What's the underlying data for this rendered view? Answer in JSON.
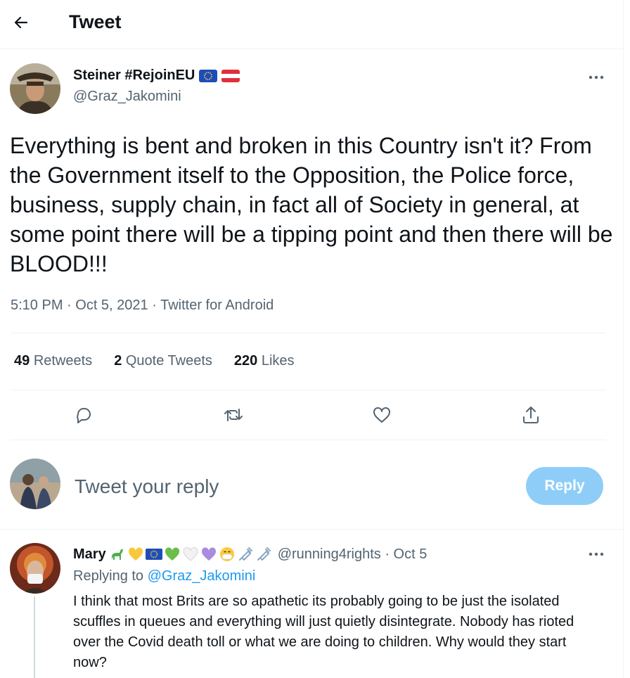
{
  "header": {
    "title": "Tweet"
  },
  "tweet": {
    "author_name": "Steiner #RejoinEU",
    "author_handle": "@Graz_Jakomini",
    "text": "Everything is bent and broken in this Country isn't it? From the Government itself to the Opposition, the Police force, business, supply chain, in fact all of Society in general, at some point there will be a tipping point and then there will be BLOOD!!!",
    "time": "5:10 PM",
    "date": "Oct 5, 2021",
    "source": "Twitter for Android",
    "retweets_count": "49",
    "retweets_label": "Retweets",
    "quotes_count": "2",
    "quotes_label": "Quote Tweets",
    "likes_count": "220",
    "likes_label": "Likes",
    "name_badges": [
      "eu-flag-icon",
      "austria-flag-icon"
    ]
  },
  "composer": {
    "placeholder": "Tweet your reply",
    "button_label": "Reply"
  },
  "reply": {
    "author_name": "Mary",
    "emojis": [
      "sauropod-icon",
      "yellow-heart-icon",
      "eu-flag-icon",
      "green-heart-icon",
      "white-heart-icon",
      "purple-heart-icon",
      "mask-face-icon",
      "syringe-icon",
      "syringe-icon"
    ],
    "author_handle": "@running4rights",
    "date": "Oct 5",
    "replying_label": "Replying to",
    "replying_to": "@Graz_Jakomini",
    "text": "I think that most Brits are so apathetic its probably going to be just the isolated scuffles in queues and everything will just quietly disintegrate. Nobody has rioted over the Covid death toll or what we are doing to children. Why would they start now?"
  },
  "colors": {
    "text": "#0f1419",
    "secondary": "#536471",
    "accent": "#1d9bf0",
    "reply_button": "#8ecdf8",
    "divider": "#eff3f4"
  }
}
